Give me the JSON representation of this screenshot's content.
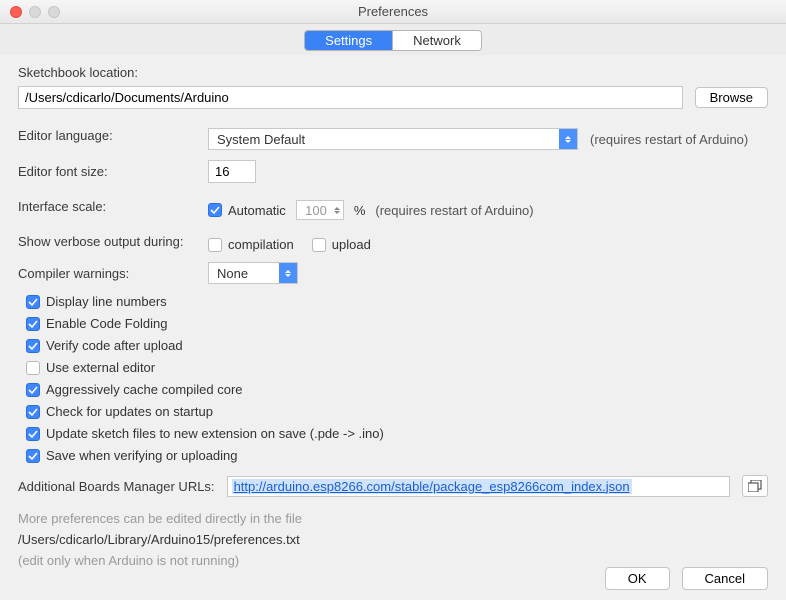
{
  "window": {
    "title": "Preferences"
  },
  "tabs": {
    "settings": "Settings",
    "network": "Network"
  },
  "sketchbook": {
    "label": "Sketchbook location:",
    "path": "/Users/cdicarlo/Documents/Arduino",
    "browse": "Browse"
  },
  "editor_language": {
    "label": "Editor language:",
    "value": "System Default",
    "hint": "(requires restart of Arduino)"
  },
  "font_size": {
    "label": "Editor font size:",
    "value": "16"
  },
  "interface_scale": {
    "label": "Interface scale:",
    "auto_label": "Automatic",
    "value": "100",
    "percent": "%",
    "hint": "(requires restart of Arduino)"
  },
  "verbose": {
    "label": "Show verbose output during:",
    "compilation": "compilation",
    "upload": "upload"
  },
  "compiler_warnings": {
    "label": "Compiler warnings:",
    "value": "None"
  },
  "checks": {
    "line_numbers": "Display line numbers",
    "code_folding": "Enable Code Folding",
    "verify_upload": "Verify code after upload",
    "external_editor": "Use external editor",
    "cache_core": "Aggressively cache compiled core",
    "check_updates": "Check for updates on startup",
    "update_ext": "Update sketch files to new extension on save (.pde -> .ino)",
    "save_verify": "Save when verifying or uploading"
  },
  "boards_url": {
    "label": "Additional Boards Manager URLs:",
    "value": "http://arduino.esp8266.com/stable/package_esp8266com_index.json"
  },
  "more_prefs": {
    "line1": "More preferences can be edited directly in the file",
    "path": "/Users/cdicarlo/Library/Arduino15/preferences.txt",
    "line2": "(edit only when Arduino is not running)"
  },
  "buttons": {
    "ok": "OK",
    "cancel": "Cancel"
  }
}
